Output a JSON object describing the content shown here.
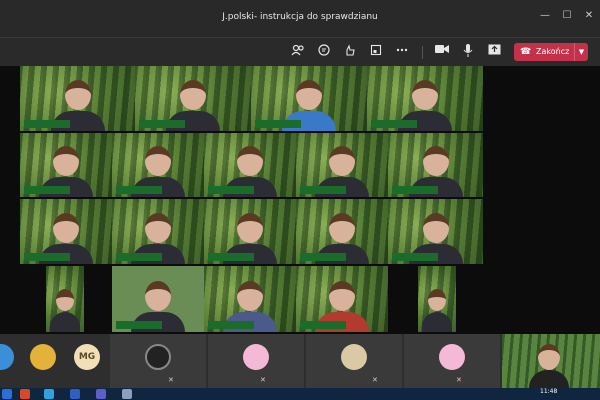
{
  "window": {
    "title": "J.polski- instrukcja do sprawdzianu"
  },
  "controls": {
    "minimize": "—",
    "maximize": "☐",
    "close": "✕"
  },
  "toolbar": {
    "icons": [
      "participants-icon",
      "chat-icon",
      "reactions-icon",
      "rooms-icon",
      "more-icon",
      "camera-icon",
      "mic-icon",
      "share-icon"
    ],
    "end_label": "Zakończ"
  },
  "bottom": {
    "avatars": [
      {
        "initials": "MG",
        "color": "#f2dfb8"
      }
    ]
  },
  "taskbar": {
    "time": "11:48"
  },
  "colors": {
    "end": "#c4314b",
    "nametag": "#1b6b2a"
  }
}
